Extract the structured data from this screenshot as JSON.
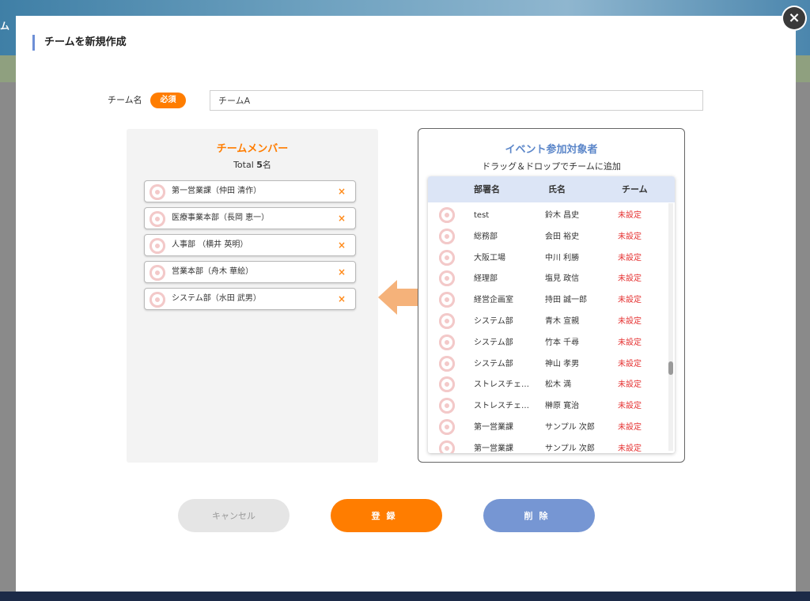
{
  "background": {
    "partial_title": "ム"
  },
  "dialog": {
    "title": "チームを新規作成",
    "close_label": "×"
  },
  "team_name": {
    "label": "チーム名",
    "required_badge": "必須",
    "value": "チームA"
  },
  "members_panel": {
    "title": "チームメンバー",
    "total_prefix": "Total ",
    "total_count": "5",
    "total_suffix": "名",
    "remove_icon_label": "×",
    "members": [
      {
        "label": "第一営業課（仲田 清作）"
      },
      {
        "label": "医療事業本部（長岡 恵一）"
      },
      {
        "label": "人事部 （横井 英明）"
      },
      {
        "label": "営業本部（舟木 華絵）"
      },
      {
        "label": "システム部（水田 武男）"
      }
    ]
  },
  "event_panel": {
    "title": "イベント参加対象者",
    "subtitle": "ドラッグ＆ドロップでチームに追加",
    "columns": [
      "部署名",
      "氏名",
      "チーム"
    ],
    "rows": [
      {
        "dept": "test",
        "name": "鈴木 昌史",
        "team": "未設定"
      },
      {
        "dept": "総務部",
        "name": "会田 裕史",
        "team": "未設定"
      },
      {
        "dept": "大阪工場",
        "name": "中川 利勝",
        "team": "未設定"
      },
      {
        "dept": "経理部",
        "name": "塩見 政信",
        "team": "未設定"
      },
      {
        "dept": "経営企画室",
        "name": "持田 誠一郎",
        "team": "未設定"
      },
      {
        "dept": "システム部",
        "name": "青木 宣親",
        "team": "未設定"
      },
      {
        "dept": "システム部",
        "name": "竹本 千尋",
        "team": "未設定"
      },
      {
        "dept": "システム部",
        "name": "神山 孝男",
        "team": "未設定"
      },
      {
        "dept": "ストレスチェ…",
        "name": "松木 満",
        "team": "未設定"
      },
      {
        "dept": "ストレスチェ…",
        "name": "榊原 寛治",
        "team": "未設定"
      },
      {
        "dept": "第一営業課",
        "name": "サンプル 次郎",
        "team": "未設定"
      },
      {
        "dept": "第一営業課",
        "name": "サンプル 次郎",
        "team": "未設定"
      }
    ]
  },
  "buttons": {
    "cancel": "キャンセル",
    "register": "登録",
    "delete": "削除"
  },
  "colors": {
    "accent_orange": "#ff7d00",
    "accent_blue": "#7696d3",
    "unset_red": "#e53030"
  }
}
